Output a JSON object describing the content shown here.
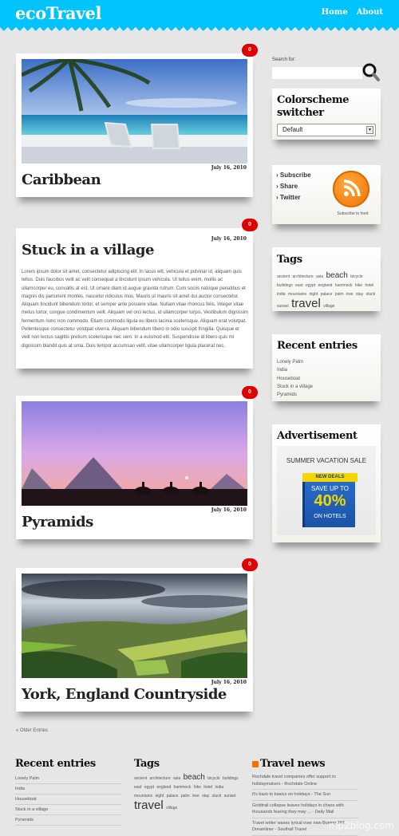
{
  "header": {
    "logo": "ecoTravel",
    "nav": [
      "Home",
      "About"
    ],
    "colors": {
      "brand": "#00c4fb",
      "badge": "#e00000"
    }
  },
  "posts": [
    {
      "title": "Caribbean",
      "date": "July 16, 2010",
      "comments": "0",
      "image": "beach-with-chairs"
    },
    {
      "title": "Stuck in a village",
      "date": "July 16, 2010",
      "comments": "0",
      "body": "Lorem ipsum dolor sit amet, consectetur adipiscing elit. In lacus elit, vehicula et pulvinar id, aliquam quis tellus. Duis faucibus velit ac velit consequat a tincidunt ipsum vehicula. Ut tellus enim, mollis ac ullamcorper eu, convallis at est. Ut ornare diam id augue gravida rutrum. Cum sociis natoque penatibus et magnis dis parturient montes, nascetur ridiculus mus. Mauris ut mauris sit amet dui auctor consectetur. Aliquam tincidunt bibendum tortor, et semper ante posuere vitae. Nullam vitae rhoncus felis. Integer vitae metus tortor, congue condimentum velit. Aliquam vel orci lectus, id ullamcorper turpis. Vestibulum dignissim fermentum nunc non commodo. Etiam commodo ligula eu libero lacinia scelerisque. Aliquam erat volutpat. Pellentesque consectetur volutpat viverra. Aliquam bibendum libero in odio suscipit fringilla. Quisque et velit non lectus sagittis pretium scelerisque nec sem. In a euismod elit. Suspendisse id libero quis mi dignissim blandit quis at urna. Duis tempor accumsan velit, vitae ullamcorper ligula placerat nec."
    },
    {
      "title": "Pyramids",
      "date": "July 16, 2010",
      "comments": "0",
      "image": "pyramids-sunset"
    },
    {
      "title": "York, England Countryside",
      "date": "July 16, 2010",
      "comments": "0",
      "image": "green-valley"
    }
  ],
  "older_entries": "« Older Entries",
  "sidebar": {
    "search_label": "Search for:",
    "search_value": "",
    "colorscheme": {
      "title": "Colorscheme switcher",
      "selected": "Default"
    },
    "subscribe": {
      "links": [
        "› Subscribe",
        "› Share",
        "› Twitter"
      ],
      "caption": "Subscribe to feed"
    },
    "tags": {
      "title": "Tags",
      "items": [
        "ancient",
        "architecture",
        "asia",
        "beach",
        "bicycle",
        "buildings",
        "east",
        "egypt",
        "england",
        "hammock",
        "hike",
        "hotel",
        "india",
        "mountains",
        "night",
        "palace",
        "palm",
        "tree",
        "stay",
        "stuck",
        "sunset",
        "travel",
        "village"
      ]
    },
    "recent": {
      "title": "Recent entries",
      "items": [
        "Lonely Palm",
        "India",
        "Houseboat",
        "Stuck in a village",
        "Pyramids"
      ]
    },
    "ad": {
      "title": "Advertisement",
      "headline": "SUMMER VACATION SALE",
      "ribbon": "NEW DEALS",
      "line1": "SAVE UP TO",
      "line2": "40%",
      "line3": "ON HOTELS"
    }
  },
  "footer": {
    "recent": {
      "title": "Recent entries",
      "items": [
        "Lonely Palm",
        "India",
        "Houseboat",
        "Stuck in a village",
        "Pyramids"
      ]
    },
    "tags": {
      "title": "Tags"
    },
    "news": {
      "title": "Travel news",
      "items": [
        "Rochdale travel companies offer support to holidaymakers - Rochdale Online",
        "It's back to basics on holidays - The Sun",
        "Goldtrail collapse leaves holidays in chaos with thousands fearing they may ... - Daily Mail",
        "Travel writer waxes lyrical over new Boeing 787 Dreamliner - Southall Travel"
      ]
    }
  },
  "watermark": "mp2blog.com"
}
